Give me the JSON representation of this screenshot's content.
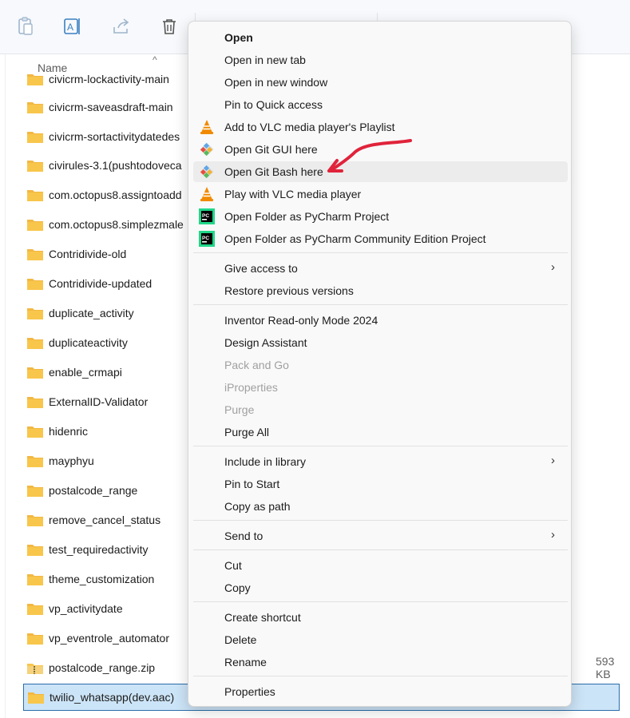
{
  "toolbar": {
    "icons": [
      "paste-icon",
      "rename-icon",
      "share-icon",
      "delete-icon"
    ]
  },
  "filelist": {
    "column_name": "Name",
    "rows": [
      {
        "name": "civicrm-lockactivity-main"
      },
      {
        "name": "civicrm-saveasdraft-main"
      },
      {
        "name": "civicrm-sortactivitydatedes"
      },
      {
        "name": "civirules-3.1(pushtodoveca"
      },
      {
        "name": "com.octopus8.assigntoadd"
      },
      {
        "name": "com.octopus8.simplezmale"
      },
      {
        "name": "Contridivide-old"
      },
      {
        "name": "Contridivide-updated"
      },
      {
        "name": "duplicate_activity"
      },
      {
        "name": "duplicateactivity"
      },
      {
        "name": "enable_crmapi"
      },
      {
        "name": "ExternalID-Validator"
      },
      {
        "name": "hidenric"
      },
      {
        "name": "mayphyu"
      },
      {
        "name": "postalcode_range"
      },
      {
        "name": "remove_cancel_status"
      },
      {
        "name": "test_requiredactivity"
      },
      {
        "name": "theme_customization"
      },
      {
        "name": "vp_activitydate"
      },
      {
        "name": "vp_eventrole_automator"
      },
      {
        "name": "postalcode_range.zip",
        "size": "593 KB",
        "zip": true
      },
      {
        "name": "twilio_whatsapp(dev.aac)",
        "selected": true
      }
    ]
  },
  "menu": {
    "items": [
      {
        "label": "Open"
      },
      {
        "label": "Open in new tab"
      },
      {
        "label": "Open in new window"
      },
      {
        "label": "Pin to Quick access"
      },
      {
        "label": "Add to VLC media player's Playlist",
        "icon": "vlc-icon"
      },
      {
        "label": "Open Git GUI here",
        "icon": "git-icon"
      },
      {
        "label": "Open Git Bash here",
        "icon": "git-icon"
      },
      {
        "label": "Play with VLC media player",
        "icon": "vlc-icon"
      },
      {
        "label": "Open Folder as PyCharm Project",
        "icon": "pycharm-icon"
      },
      {
        "label": "Open Folder as PyCharm Community Edition Project",
        "icon": "pycharm-icon"
      },
      {
        "label": "Give access to"
      },
      {
        "label": "Restore previous versions"
      },
      {
        "label": "Inventor Read-only Mode 2024"
      },
      {
        "label": "Design Assistant"
      },
      {
        "label": "Pack and Go",
        "disabled": true
      },
      {
        "label": "iProperties",
        "disabled": true
      },
      {
        "label": "Purge",
        "disabled": true
      },
      {
        "label": "Purge All"
      },
      {
        "label": "Include in library"
      },
      {
        "label": "Pin to Start"
      },
      {
        "label": "Copy as path"
      },
      {
        "label": "Send to"
      },
      {
        "label": "Cut"
      },
      {
        "label": "Copy"
      },
      {
        "label": "Create shortcut"
      },
      {
        "label": "Delete"
      },
      {
        "label": "Rename"
      },
      {
        "label": "Properties"
      }
    ]
  },
  "colors": {
    "selection_bg": "#cce4f7",
    "selection_border": "#2b6dab",
    "folder": "#f8c64b",
    "annotation_arrow": "#e0233b"
  }
}
